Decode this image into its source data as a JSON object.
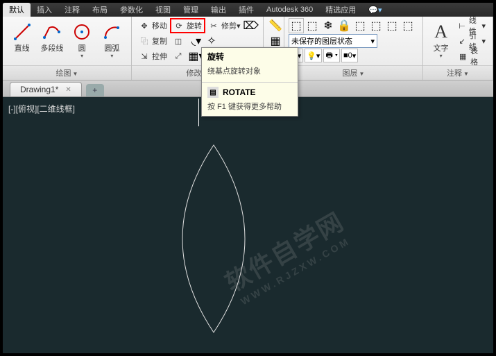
{
  "menu": {
    "tabs": [
      "默认",
      "插入",
      "注释",
      "布局",
      "参数化",
      "视图",
      "管理",
      "输出",
      "插件",
      "Autodesk 360",
      "精选应用"
    ],
    "active_index": 0
  },
  "panels": {
    "draw": {
      "title": "绘图",
      "line": "直线",
      "polyline": "多段线",
      "circle": "圆",
      "arc": "圆弧"
    },
    "modify": {
      "title": "修改",
      "move": "移动",
      "copy": "复制",
      "stretch": "拉伸",
      "rotate": "旋转",
      "trim": "修剪"
    },
    "layers": {
      "title": "图层",
      "unsaved": "未保存的图层状态",
      "name": "0"
    },
    "annotate": {
      "title": "注释",
      "text": "文字",
      "linear": "线性",
      "leader": "引线",
      "table": "表格"
    }
  },
  "tooltip": {
    "title": "旋转",
    "sub": "绕基点旋转对象",
    "command": "ROTATE",
    "help": "按 F1 键获得更多帮助"
  },
  "doc": {
    "name": "Drawing1*"
  },
  "viewport": {
    "label": "[-][俯视][二维线框]"
  },
  "watermark": {
    "main": "软件自学网",
    "sub": "WWW.RJZXW.COM"
  }
}
